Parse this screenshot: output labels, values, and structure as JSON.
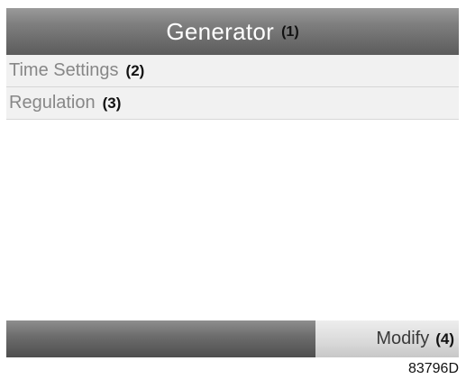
{
  "header": {
    "title": "Generator",
    "callout": "(1)"
  },
  "menu": {
    "items": [
      {
        "label": "Time Settings",
        "callout": "(2)"
      },
      {
        "label": "Regulation",
        "callout": "(3)"
      }
    ]
  },
  "footer": {
    "modify_label": "Modify",
    "modify_callout": "(4)"
  },
  "figure_id": "83796D",
  "colors": {
    "title_bar": "#7e7e7e",
    "menu_text": "#878787",
    "menu_background": "#f1f1f1",
    "softkey_bar_left": "#6e6e6e",
    "softkey_button": "#d9d9d9"
  }
}
